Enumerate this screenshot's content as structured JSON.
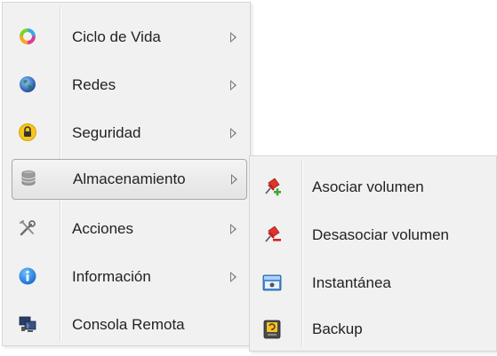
{
  "main_menu": {
    "items": [
      {
        "label": "Ciclo de Vida",
        "icon": "lifecycle-icon",
        "has_submenu": true
      },
      {
        "label": "Redes",
        "icon": "globe-icon",
        "has_submenu": true
      },
      {
        "label": "Seguridad",
        "icon": "lock-icon",
        "has_submenu": true
      },
      {
        "label": "Almacenamiento",
        "icon": "storage-icon",
        "has_submenu": true,
        "selected": true
      },
      {
        "label": "Acciones",
        "icon": "tools-icon",
        "has_submenu": true
      },
      {
        "label": "Información",
        "icon": "info-icon",
        "has_submenu": true
      },
      {
        "label": "Consola Remota",
        "icon": "console-icon",
        "has_submenu": false
      }
    ]
  },
  "submenu": {
    "items": [
      {
        "label": "Asociar volumen",
        "icon": "pin-add-icon"
      },
      {
        "label": "Desasociar volumen",
        "icon": "pin-remove-icon"
      },
      {
        "label": "Instantánea",
        "icon": "snapshot-icon"
      },
      {
        "label": "Backup",
        "icon": "backup-icon"
      }
    ]
  },
  "colors": {
    "menu_background": "#f1f1f1",
    "menu_border": "#d7d7d7",
    "selected_border": "#a9a9a9",
    "arrow": "#777777",
    "text": "#222222"
  }
}
